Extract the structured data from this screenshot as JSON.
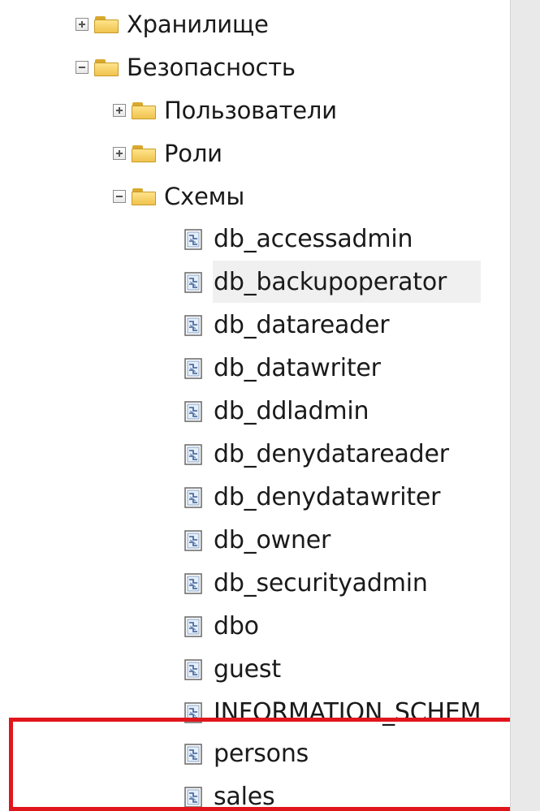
{
  "tree": {
    "nodes": [
      {
        "label": "Хранилище",
        "type": "folder",
        "state": "collapsed",
        "icon": "folder-icon"
      },
      {
        "label": "Безопасность",
        "type": "folder",
        "state": "expanded",
        "icon": "folder-icon"
      },
      {
        "label": "Пользователи",
        "type": "folder",
        "state": "collapsed",
        "icon": "folder-icon"
      },
      {
        "label": "Роли",
        "type": "folder",
        "state": "collapsed",
        "icon": "folder-icon"
      },
      {
        "label": "Схемы",
        "type": "folder",
        "state": "expanded",
        "icon": "folder-icon"
      },
      {
        "label": "db_accessadmin",
        "type": "schema",
        "icon": "schema-icon"
      },
      {
        "label": "db_backupoperator",
        "type": "schema",
        "icon": "schema-icon",
        "hovered": true
      },
      {
        "label": "db_datareader",
        "type": "schema",
        "icon": "schema-icon"
      },
      {
        "label": "db_datawriter",
        "type": "schema",
        "icon": "schema-icon"
      },
      {
        "label": "db_ddladmin",
        "type": "schema",
        "icon": "schema-icon"
      },
      {
        "label": "db_denydatareader",
        "type": "schema",
        "icon": "schema-icon"
      },
      {
        "label": "db_denydatawriter",
        "type": "schema",
        "icon": "schema-icon"
      },
      {
        "label": "db_owner",
        "type": "schema",
        "icon": "schema-icon"
      },
      {
        "label": "db_securityadmin",
        "type": "schema",
        "icon": "schema-icon"
      },
      {
        "label": "dbo",
        "type": "schema",
        "icon": "schema-icon"
      },
      {
        "label": "guest",
        "type": "schema",
        "icon": "schema-icon"
      },
      {
        "label": "INFORMATION_SCHEM",
        "type": "schema",
        "icon": "schema-icon"
      },
      {
        "label": "persons",
        "type": "schema",
        "icon": "schema-icon",
        "highlighted": true
      },
      {
        "label": "sales",
        "type": "schema",
        "icon": "schema-icon",
        "highlighted": true
      }
    ]
  },
  "colors": {
    "callout_border": "#e0161c",
    "hover_background": "#f0f0f0",
    "folder_fill": "#f0c34e",
    "scrollbar": "#e9e9e9"
  }
}
